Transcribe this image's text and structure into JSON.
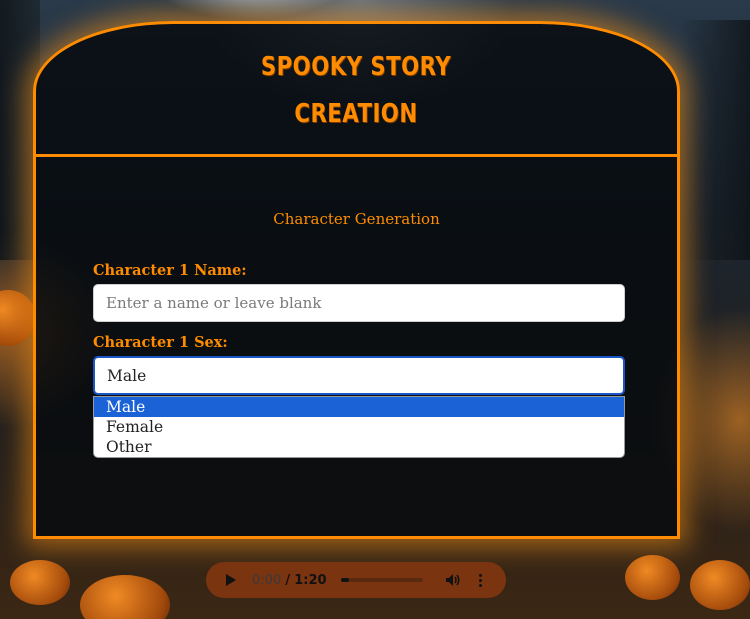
{
  "header": {
    "title_line1": "SPOOKY STORY",
    "title_line2": "CREATION"
  },
  "section": {
    "title": "Character Generation"
  },
  "form": {
    "name_label": "Character 1 Name:",
    "name_placeholder": "Enter a name or leave blank",
    "name_value": "",
    "sex_label": "Character 1 Sex:",
    "sex_selected": "Male",
    "sex_options": [
      "Male",
      "Female",
      "Other"
    ],
    "sex_highlighted_index": 0
  },
  "audio": {
    "current_time": "0:00",
    "separator": "/",
    "total_time": "1:20",
    "progress_fraction": 0.0
  },
  "colors": {
    "accent": "#ff8c00",
    "select_highlight": "#1a62d6",
    "audio_bg": "#7a3410"
  },
  "icons": {
    "play": "play-icon",
    "volume": "volume-icon",
    "more": "more-options-icon"
  }
}
